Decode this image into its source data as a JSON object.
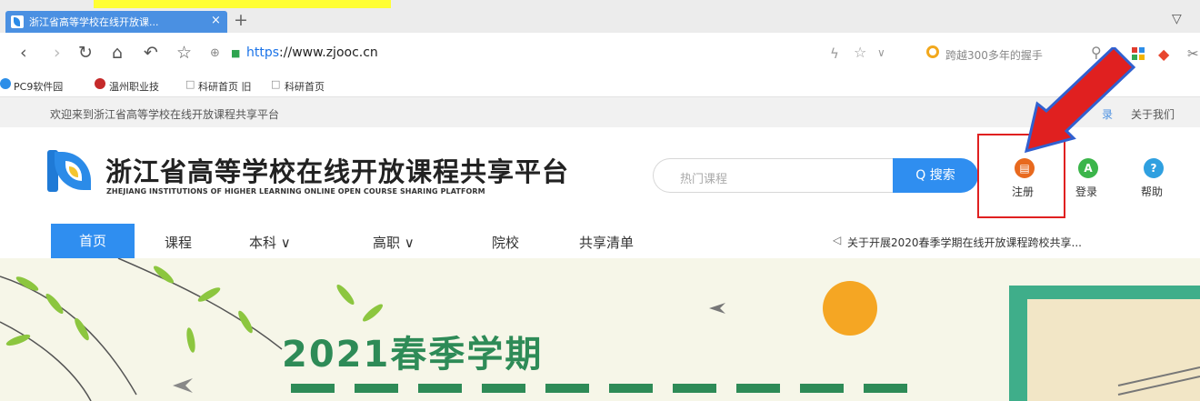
{
  "browser": {
    "tab_title": "浙江省高等学校在线开放课...",
    "tab_close": "×",
    "new_tab": "+",
    "url_scheme": "https",
    "url_rest": "://www.zjooc.cn",
    "search_suggestion": "跨越300多年的握手",
    "bookmarks": [
      "PC9软件园",
      "温州职业技",
      "科研首页 旧",
      "科研首页"
    ]
  },
  "site": {
    "welcome": "欢迎来到浙江省高等学校在线开放课程共享平台",
    "about": "关于我们",
    "about_partial": "录",
    "title": "浙江省高等学校在线开放课程共享平台",
    "subtitle": "ZHEJIANG INSTITUTIONS OF HIGHER LEARNING ONLINE OPEN COURSE SHARING PLATFORM",
    "search_placeholder": "热门课程",
    "search_button": "Q 搜索",
    "register": "注册",
    "login": "登录",
    "help": "帮助",
    "menu": [
      "首页",
      "课程",
      "本科 ∨",
      "高职 ∨",
      "院校",
      "共享清单"
    ],
    "notice": "关于开展2020春季学期在线开放课程跨校共享...",
    "banner_line1": "2021春季学期"
  },
  "colors": {
    "accent": "#2f8ef0",
    "register": "#e8691e",
    "login": "#3bb54a",
    "help": "#2fa0e0",
    "annotation": "#e02020"
  }
}
